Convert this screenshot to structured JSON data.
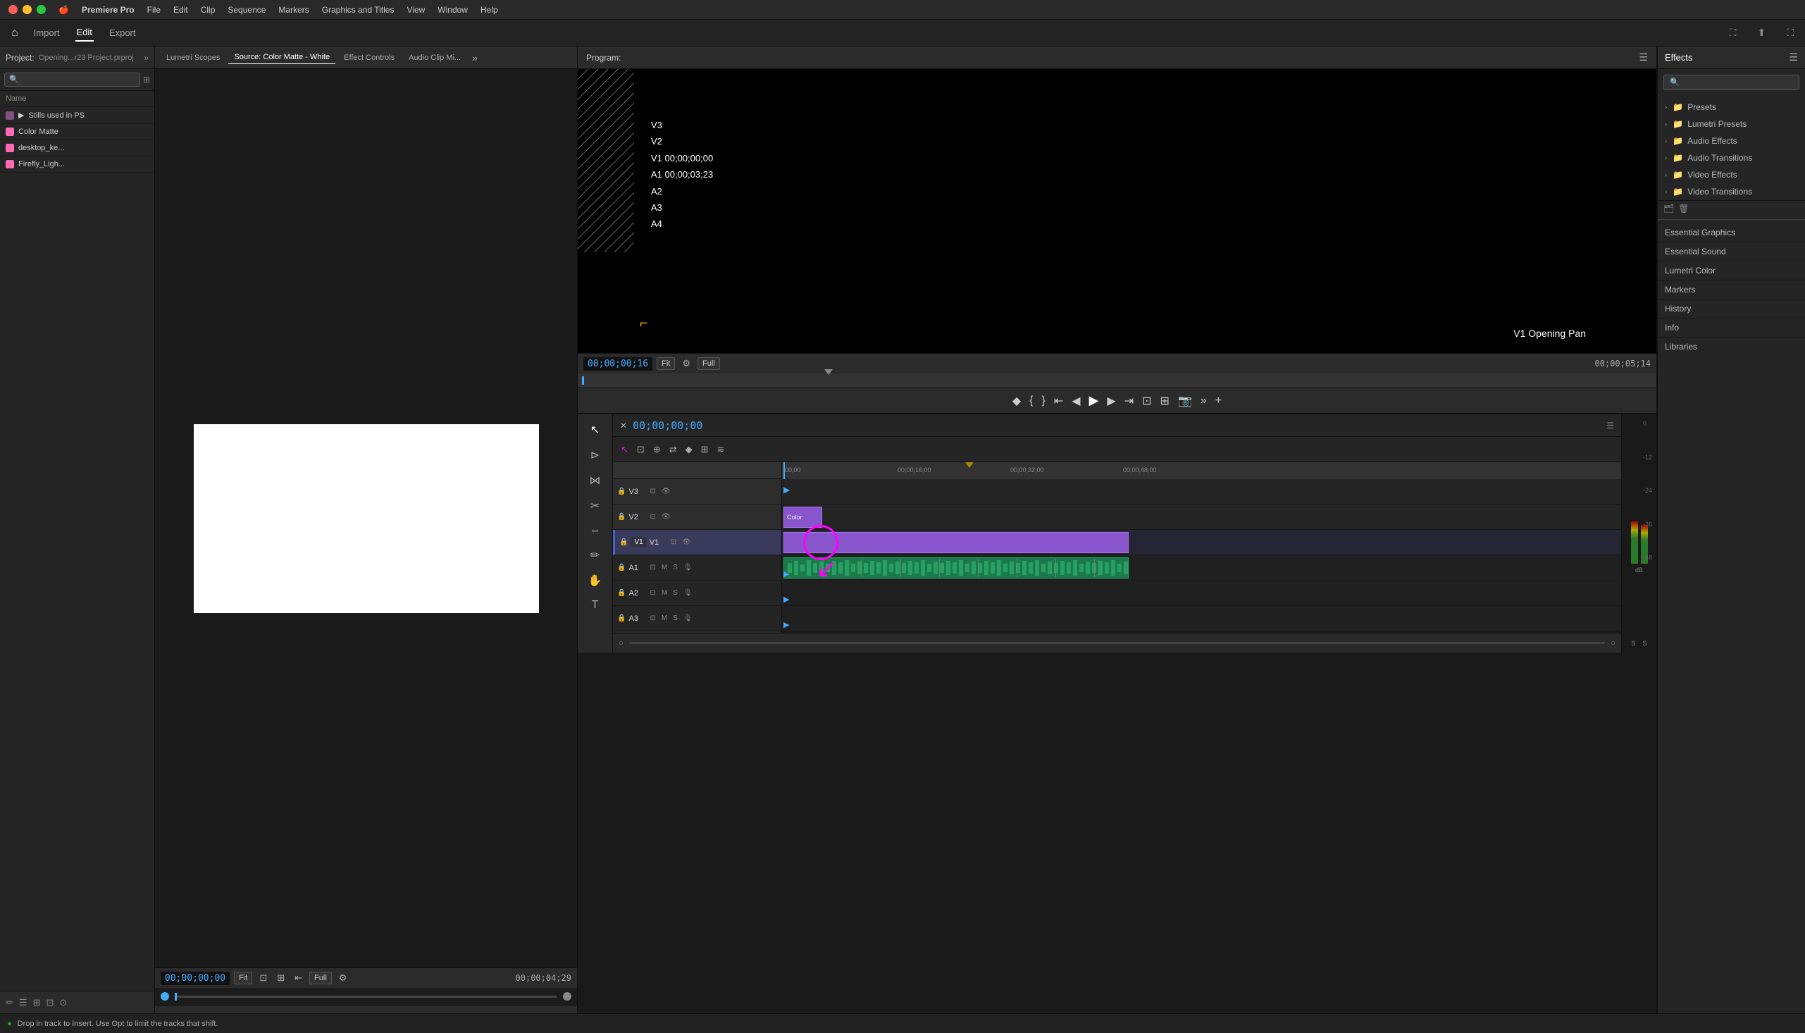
{
  "app": {
    "name": "Premiere Pro",
    "menu_items": [
      "File",
      "Edit",
      "Clip",
      "Sequence",
      "Markers",
      "Graphics and Titles",
      "View",
      "Window",
      "Help"
    ]
  },
  "workspace": {
    "import_label": "Import",
    "edit_label": "Edit",
    "export_label": "Export"
  },
  "source_panel": {
    "tabs": [
      {
        "label": "Lumetri Scopes",
        "active": false
      },
      {
        "label": "Source: Color Matte - White",
        "active": true
      },
      {
        "label": "Effect Controls",
        "active": false
      },
      {
        "label": "Audio Clip Mi...",
        "active": false
      }
    ],
    "timecode": "00;00;00;00",
    "fit": "Fit",
    "quality": "Full",
    "duration": "00;00;04;29"
  },
  "program_panel": {
    "label": "Program:",
    "timecode": "00;00;00;16",
    "fit": "Fit",
    "quality": "Full",
    "duration": "00;00;05;14",
    "overlay": {
      "v3": "V3",
      "v2": "V2",
      "v1": "V1 00;00;00;00",
      "a1": "A1 00;00;03;23",
      "a2": "A2",
      "a3": "A3",
      "a4": "A4"
    },
    "clip_label": "V1 Opening Pan"
  },
  "effects_panel": {
    "title": "Effects",
    "search_placeholder": "🔍",
    "items": [
      {
        "label": "Presets",
        "type": "folder"
      },
      {
        "label": "Lumetri Presets",
        "type": "folder"
      },
      {
        "label": "Audio Effects",
        "type": "folder"
      },
      {
        "label": "Audio Transitions",
        "type": "folder"
      },
      {
        "label": "Video Effects",
        "type": "folder"
      },
      {
        "label": "Video Transitions",
        "type": "folder"
      }
    ],
    "panel_items": [
      {
        "label": "Essential Graphics"
      },
      {
        "label": "Essential Sound"
      },
      {
        "label": "Lumetri Color"
      },
      {
        "label": "Markers"
      },
      {
        "label": "History"
      },
      {
        "label": "Info"
      },
      {
        "label": "Libraries"
      }
    ]
  },
  "project_panel": {
    "label": "Project:",
    "project_name": "Opening...r23 Project.prproj",
    "items": [
      {
        "name": "Stills used in PS",
        "type": "folder",
        "color": "#805080"
      },
      {
        "name": "Color Matte",
        "type": "file",
        "color": "#ff69b4"
      },
      {
        "name": "desktop_ke...",
        "type": "file",
        "color": "#ff69b4"
      },
      {
        "name": "Firefly_Ligh...",
        "type": "file",
        "color": "#ff69b4"
      }
    ]
  },
  "timeline": {
    "timecode": "00;00;00;00",
    "ruler_marks": [
      "00;00",
      "00;00;16;00",
      "00;00;32;00",
      "00;00;48;00"
    ],
    "tracks": [
      {
        "name": "V3",
        "type": "video"
      },
      {
        "name": "V2",
        "type": "video"
      },
      {
        "name": "V1",
        "type": "video",
        "active": true
      },
      {
        "name": "A1",
        "type": "audio"
      },
      {
        "name": "A2",
        "type": "audio"
      },
      {
        "name": "A3",
        "type": "audio"
      }
    ]
  },
  "audio_meters": {
    "labels": [
      "0",
      "-12",
      "-24",
      "-36",
      "-48"
    ],
    "db_label": "dB",
    "s_labels": [
      "S",
      "S"
    ]
  },
  "status_bar": {
    "message": "Drop in track to Insert. Use Opt to limit the tracks that shift."
  },
  "icons": {
    "close": "✕",
    "menu": "☰",
    "search": "🔍",
    "folder": "📁",
    "play": "▶",
    "stop": "■",
    "rewind": "◀◀",
    "fast_forward": "▶▶",
    "step_back": "◀",
    "step_forward": "▶",
    "loop": "↺",
    "camera": "📷",
    "lock": "🔒",
    "eye": "👁",
    "mic": "🎙",
    "chevron_right": "›",
    "chevron_down": "⌄",
    "plus": "+",
    "expand": "»"
  }
}
